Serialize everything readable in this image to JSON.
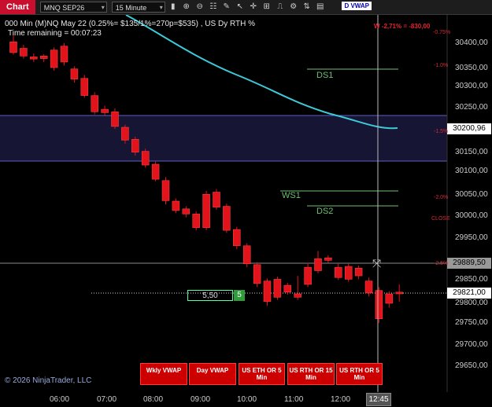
{
  "toolbar": {
    "chart_tab": "Chart",
    "instrument": "MNQ SEP26",
    "interval": "15 Minute",
    "vwap_badge": "D VWAP"
  },
  "icons": [
    "bars-icon",
    "zoom-in-icon",
    "zoom-out-icon",
    "properties-icon",
    "draw-icon",
    "cursor-icon",
    "crosshair-icon",
    "templates-icon",
    "indicators-icon",
    "strategies-icon",
    "chart-trader-icon"
  ],
  "info": {
    "line1": "000 Min (M)NQ May 22 (0.25%= $135/1%=270p=$535) , US Dy RTH %",
    "line2": "Time remaining = 00:07:23",
    "pnl": "W -2,71% = -830,00"
  },
  "copyright": "© 2026 NinjaTrader, LLC",
  "y_axis": [
    "30400,00",
    "30350,00",
    "30300,00",
    "30250,00",
    "30200,96",
    "30150,00",
    "30100,00",
    "30050,00",
    "30000,00",
    "29950,00",
    "29889,50",
    "29850,00",
    "29821,00",
    "29800,00",
    "29750,00",
    "29700,00",
    "29650,00"
  ],
  "pct_labels": [
    "-0.75%",
    "-1.0%",
    "-1.5%",
    "-2.0%",
    "CLOSE",
    "-2.5%"
  ],
  "x_axis": [
    "06:00",
    "07:00",
    "08:00",
    "09:00",
    "10:00",
    "11:00",
    "12:00"
  ],
  "x_cursor": "12:45",
  "levels": {
    "ds1": "DS1",
    "ws1": "WS1",
    "ds2": "DS2"
  },
  "position_box": {
    "value": "5,50",
    "qty": "5"
  },
  "buttons": {
    "wkly_vwap": "Wkly VWAP",
    "day_vwap": "Day VWAP",
    "eth_or": "US ETH OR 5 Min",
    "rth_or15": "US RTH OR 15 Min",
    "rth_or5": "US RTH OR 5 Min"
  },
  "colors": {
    "candle": "#e3131b",
    "vwap": "#3dc9d8",
    "band": "#1a1a3a",
    "band_border": "#5a5ab0",
    "level": "#6fbf73"
  },
  "candles": [
    [
      30405,
      30380,
      30420,
      30375
    ],
    [
      30390,
      30372,
      30398,
      30366
    ],
    [
      30370,
      30365,
      30378,
      30358
    ],
    [
      30366,
      30372,
      30376,
      30358
    ],
    [
      30386,
      30345,
      30392,
      30338
    ],
    [
      30395,
      30358,
      30402,
      30350
    ],
    [
      30342,
      30318,
      30348,
      30310
    ],
    [
      30320,
      30280,
      30328,
      30275
    ],
    [
      30280,
      30242,
      30288,
      30236
    ],
    [
      30248,
      30240,
      30256,
      30234
    ],
    [
      30242,
      30208,
      30250,
      30202
    ],
    [
      30206,
      30176,
      30212,
      30168
    ],
    [
      30178,
      30148,
      30184,
      30140
    ],
    [
      30150,
      30118,
      30156,
      30112
    ],
    [
      30120,
      30085,
      30126,
      30080
    ],
    [
      30082,
      30035,
      30090,
      30026
    ],
    [
      30034,
      30012,
      30040,
      30006
    ],
    [
      30016,
      30004,
      30022,
      29996
    ],
    [
      30004,
      29972,
      30010,
      29966
    ],
    [
      29972,
      30050,
      30058,
      29966
    ],
    [
      30055,
      30020,
      30062,
      30014
    ],
    [
      30022,
      29966,
      30028,
      29960
    ],
    [
      29968,
      29930,
      29974,
      29922
    ],
    [
      29930,
      29888,
      29936,
      29880
    ],
    [
      29886,
      29842,
      29892,
      29834
    ],
    [
      29848,
      29800,
      29854,
      29790
    ],
    [
      29852,
      29810,
      29858,
      29804
    ],
    [
      29838,
      29822,
      29844,
      29816
    ],
    [
      29818,
      29810,
      29860,
      29804
    ],
    [
      29840,
      29880,
      29890,
      29834
    ],
    [
      29900,
      29872,
      29918,
      29866
    ],
    [
      29896,
      29902,
      29908,
      29890
    ],
    [
      29880,
      29856,
      29888,
      29850
    ],
    [
      29882,
      29852,
      29888,
      29846
    ],
    [
      29878,
      29860,
      29884,
      29852
    ],
    [
      29848,
      29820,
      29856,
      29812
    ],
    [
      29826,
      29760,
      29834,
      29750
    ],
    [
      29818,
      29796,
      29824,
      29786
    ],
    [
      29822,
      29818,
      29840,
      29800
    ]
  ]
}
